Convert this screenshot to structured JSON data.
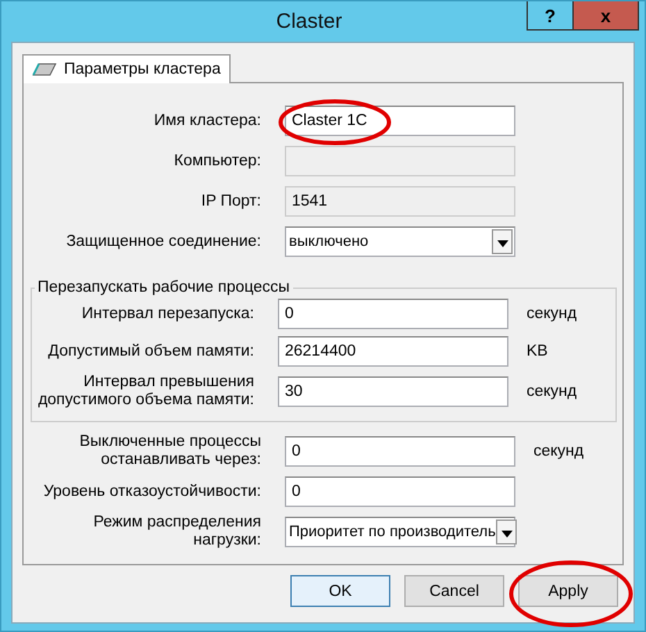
{
  "window": {
    "title": "Claster",
    "buttons": [
      {
        "kind": "help",
        "label": "?"
      },
      {
        "kind": "close",
        "label": "x"
      }
    ]
  },
  "tabs": [
    {
      "label": "Параметры кластера",
      "selected": true
    }
  ],
  "sections": [
    {
      "kind": "rows",
      "rows": [
        {
          "label": "Имя кластера:",
          "value": "Claster 1C",
          "kind": "input",
          "highlighted": true
        },
        {
          "label": "Компьютер:",
          "kind": "readonly"
        },
        {
          "label": "IP Порт:",
          "value": "1541",
          "kind": "readonly"
        },
        {
          "label": "Защищенное соединение:",
          "value": "выключено",
          "kind": "select"
        }
      ]
    },
    {
      "kind": "group",
      "title": "Перезапускать рабочие процессы",
      "rows": [
        {
          "label": "Интервал перезапуска:",
          "value": "0",
          "kind": "input",
          "unit": "секунд"
        },
        {
          "label": "Допустимый объем памяти:",
          "value": "26214400",
          "kind": "input",
          "unit": "KB"
        },
        {
          "label": "Интервал превышения допустимого объема памяти:",
          "value": "30",
          "kind": "input",
          "unit": "секунд"
        }
      ]
    },
    {
      "kind": "rows",
      "rows": [
        {
          "label": "Выключенные процессы останавливать через:",
          "value": "0",
          "kind": "input",
          "unit": "секунд"
        },
        {
          "label": "Уровень отказоустойчивости:",
          "value": "0",
          "kind": "input"
        },
        {
          "label": "Режим распределения нагрузки:",
          "value": "Приоритет по производитель",
          "kind": "select"
        }
      ]
    }
  ],
  "buttons": [
    {
      "label": "OK",
      "default": true,
      "highlighted": false
    },
    {
      "label": "Cancel",
      "default": false,
      "highlighted": false
    },
    {
      "label": "Apply",
      "default": false,
      "highlighted": true
    }
  ]
}
